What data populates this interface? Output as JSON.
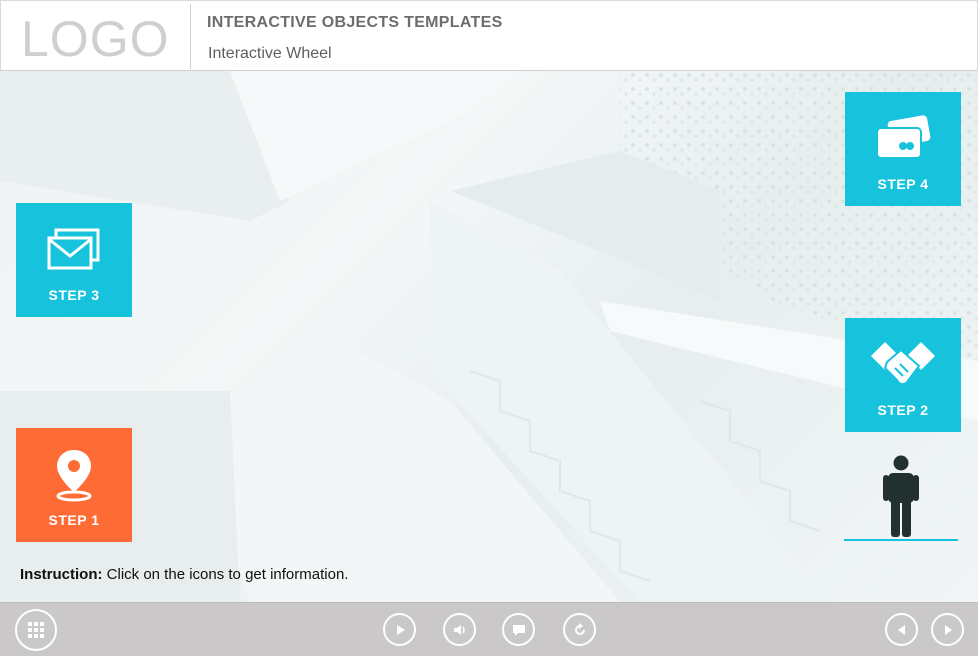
{
  "header": {
    "logo": "LOGO",
    "course_title": "INTERACTIVE OBJECTS TEMPLATES",
    "slide_title": "Interactive Wheel"
  },
  "steps": [
    {
      "label": "STEP 1",
      "icon": "map-pin-icon",
      "color": "#ff6b35"
    },
    {
      "label": "STEP 2",
      "icon": "handshake-icon",
      "color": "#17c3dc"
    },
    {
      "label": "STEP 3",
      "icon": "mail-icon",
      "color": "#17c3dc"
    },
    {
      "label": "STEP 4",
      "icon": "credit-card-icon",
      "color": "#17c3dc"
    }
  ],
  "instruction": {
    "label": "Instruction:",
    "text": " Click on the icons to get information."
  },
  "controls": {
    "menu": "menu-grid-icon",
    "play": "play-icon",
    "audio": "speaker-icon",
    "captions": "captions-icon",
    "replay": "replay-icon",
    "prev": "previous-icon",
    "next": "next-icon"
  },
  "colors": {
    "accent_cyan": "#17c3dc",
    "accent_orange": "#ff6b35",
    "bar": "#cbc8c9"
  }
}
